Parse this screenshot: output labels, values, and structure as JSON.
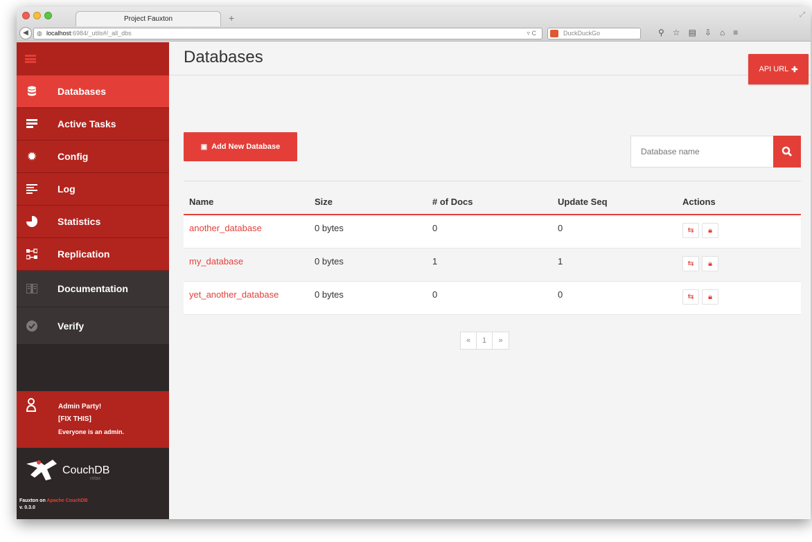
{
  "browser": {
    "tab_title": "Project Fauxton",
    "new_tab": "+",
    "url_host": "localhost",
    "url_path": ":6984/_utils#/_all_dbs",
    "search_engine": "DuckDuckGo"
  },
  "sidebar": {
    "items": [
      {
        "label": "Databases",
        "icon": "database-icon"
      },
      {
        "label": "Active Tasks",
        "icon": "tasks-icon"
      },
      {
        "label": "Config",
        "icon": "gear-icon"
      },
      {
        "label": "Log",
        "icon": "log-icon"
      },
      {
        "label": "Statistics",
        "icon": "pie-chart-icon"
      },
      {
        "label": "Replication",
        "icon": "replication-icon"
      },
      {
        "label": "Documentation",
        "icon": "book-icon"
      },
      {
        "label": "Verify",
        "icon": "check-circle-icon"
      }
    ],
    "user": {
      "line1": "Admin Party!",
      "line2": "[FIX THIS]",
      "line3": "Everyone is an admin."
    },
    "brand": {
      "name": "CouchDB",
      "tagline": "relax",
      "footer_prefix": "Fauxton on",
      "footer_link": "Apache CouchDB",
      "version": "v. 0.3.0"
    }
  },
  "main": {
    "title": "Databases",
    "api_url_label": "API URL",
    "add_db_label": "Add New Database",
    "search_placeholder": "Database name",
    "columns": [
      "Name",
      "Size",
      "# of Docs",
      "Update Seq",
      "Actions"
    ],
    "rows": [
      {
        "name": "another_database",
        "size": "0 bytes",
        "docs": "0",
        "seq": "0"
      },
      {
        "name": "my_database",
        "size": "0 bytes",
        "docs": "1",
        "seq": "1"
      },
      {
        "name": "yet_another_database",
        "size": "0 bytes",
        "docs": "0",
        "seq": "0"
      }
    ],
    "pagination": {
      "prev": "«",
      "page": "1",
      "next": "»"
    }
  },
  "colors": {
    "accent": "#e33f38",
    "sidebar_red": "#b2241e",
    "sidebar_dark": "#2e2727"
  }
}
